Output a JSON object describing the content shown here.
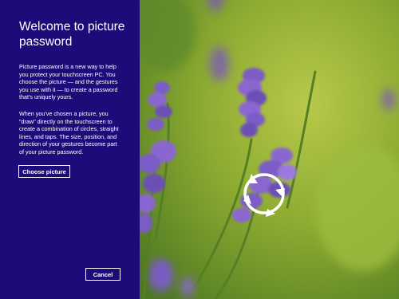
{
  "left_panel": {
    "title": "Welcome to picture\npassword",
    "paragraph1": "Picture password is a new way to help\nyou protect your touchscreen PC. You\nchoose the picture — and the gestures\nyou use with it — to create a password\nthat's uniquely yours.",
    "paragraph2": "When you've chosen a picture, you\n\"draw\" directly on the touchscreen to\ncreate a combination of circles, straight\nlines, and taps. The size, position, and\ndirection of your gestures become part\nof your picture password.",
    "choose_picture_label": "Choose picture",
    "cancel_label": "Cancel",
    "background_color": "#1e0a78"
  },
  "picture": {
    "subject": "lavender flowers photo",
    "gesture_icon": "circle-gesture-icon",
    "accent_colors": [
      "#7ea82b",
      "#7b5bc7"
    ]
  }
}
